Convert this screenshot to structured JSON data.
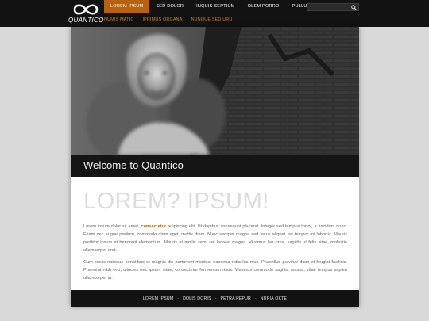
{
  "brand": {
    "name": "QUANTICO"
  },
  "nav": {
    "items": [
      {
        "label": "LOREM IPSUM",
        "active": true
      },
      {
        "label": "SED DOLOR",
        "active": false
      },
      {
        "label": "INQUIS SEPTIUM",
        "active": false
      },
      {
        "label": "OLEM PORRO",
        "active": false
      },
      {
        "label": "PULLUS IMPOUS",
        "active": false
      }
    ],
    "subitems": [
      {
        "label": "NUMIS MATIC"
      },
      {
        "label": "IPRIMUS ORGANA"
      },
      {
        "label": "NUNQUE SED URU"
      }
    ]
  },
  "search": {
    "value": "",
    "icon": "search-icon"
  },
  "hero": {
    "caption": "Welcome to Quantico"
  },
  "content": {
    "headline": "LOREM? IPSUM!",
    "p1_before": "Lorem ipsum dolor sit amet, ",
    "p1_highlight": "consectetur",
    "p1_after": " adipiscing elit. Ut dapibus consequat placerat. Integer sed tempus tortor, a tincidunt nunc. Etiam nec augue pretium, commodo diam eget, mattis diam. Nunc semper magna sed lacus aliquet, ac tempor mi lobortis. Mauris porttitor ipsum at hendrerit elementum. Mauris et mollis sem, vel laoreet magna. Vivamus leo urna, sagittis ut felis vitae, molestie ullamcorper erat.",
    "p2": "Cum sociis natoque penatibus et magnis dis parturient montes, nascetur ridiculus mus. Phasellus pulvinar diam et feugiat facilisis. Praesent nibh orci, ultricies nec ipsum vitae, consectetur fermentum risus. Vivamus commodo sagittis massa, vitae tempus sapien ullamcorper in."
  },
  "footer": {
    "links": [
      "LOREM IPSUM",
      "DOLIS DORIS",
      "PETRA PEPUR",
      "NURIA OKTE"
    ],
    "separator": "-"
  },
  "colors": {
    "accent": "#b8620f",
    "bar": "#121212",
    "background": "#d9d9d9"
  }
}
